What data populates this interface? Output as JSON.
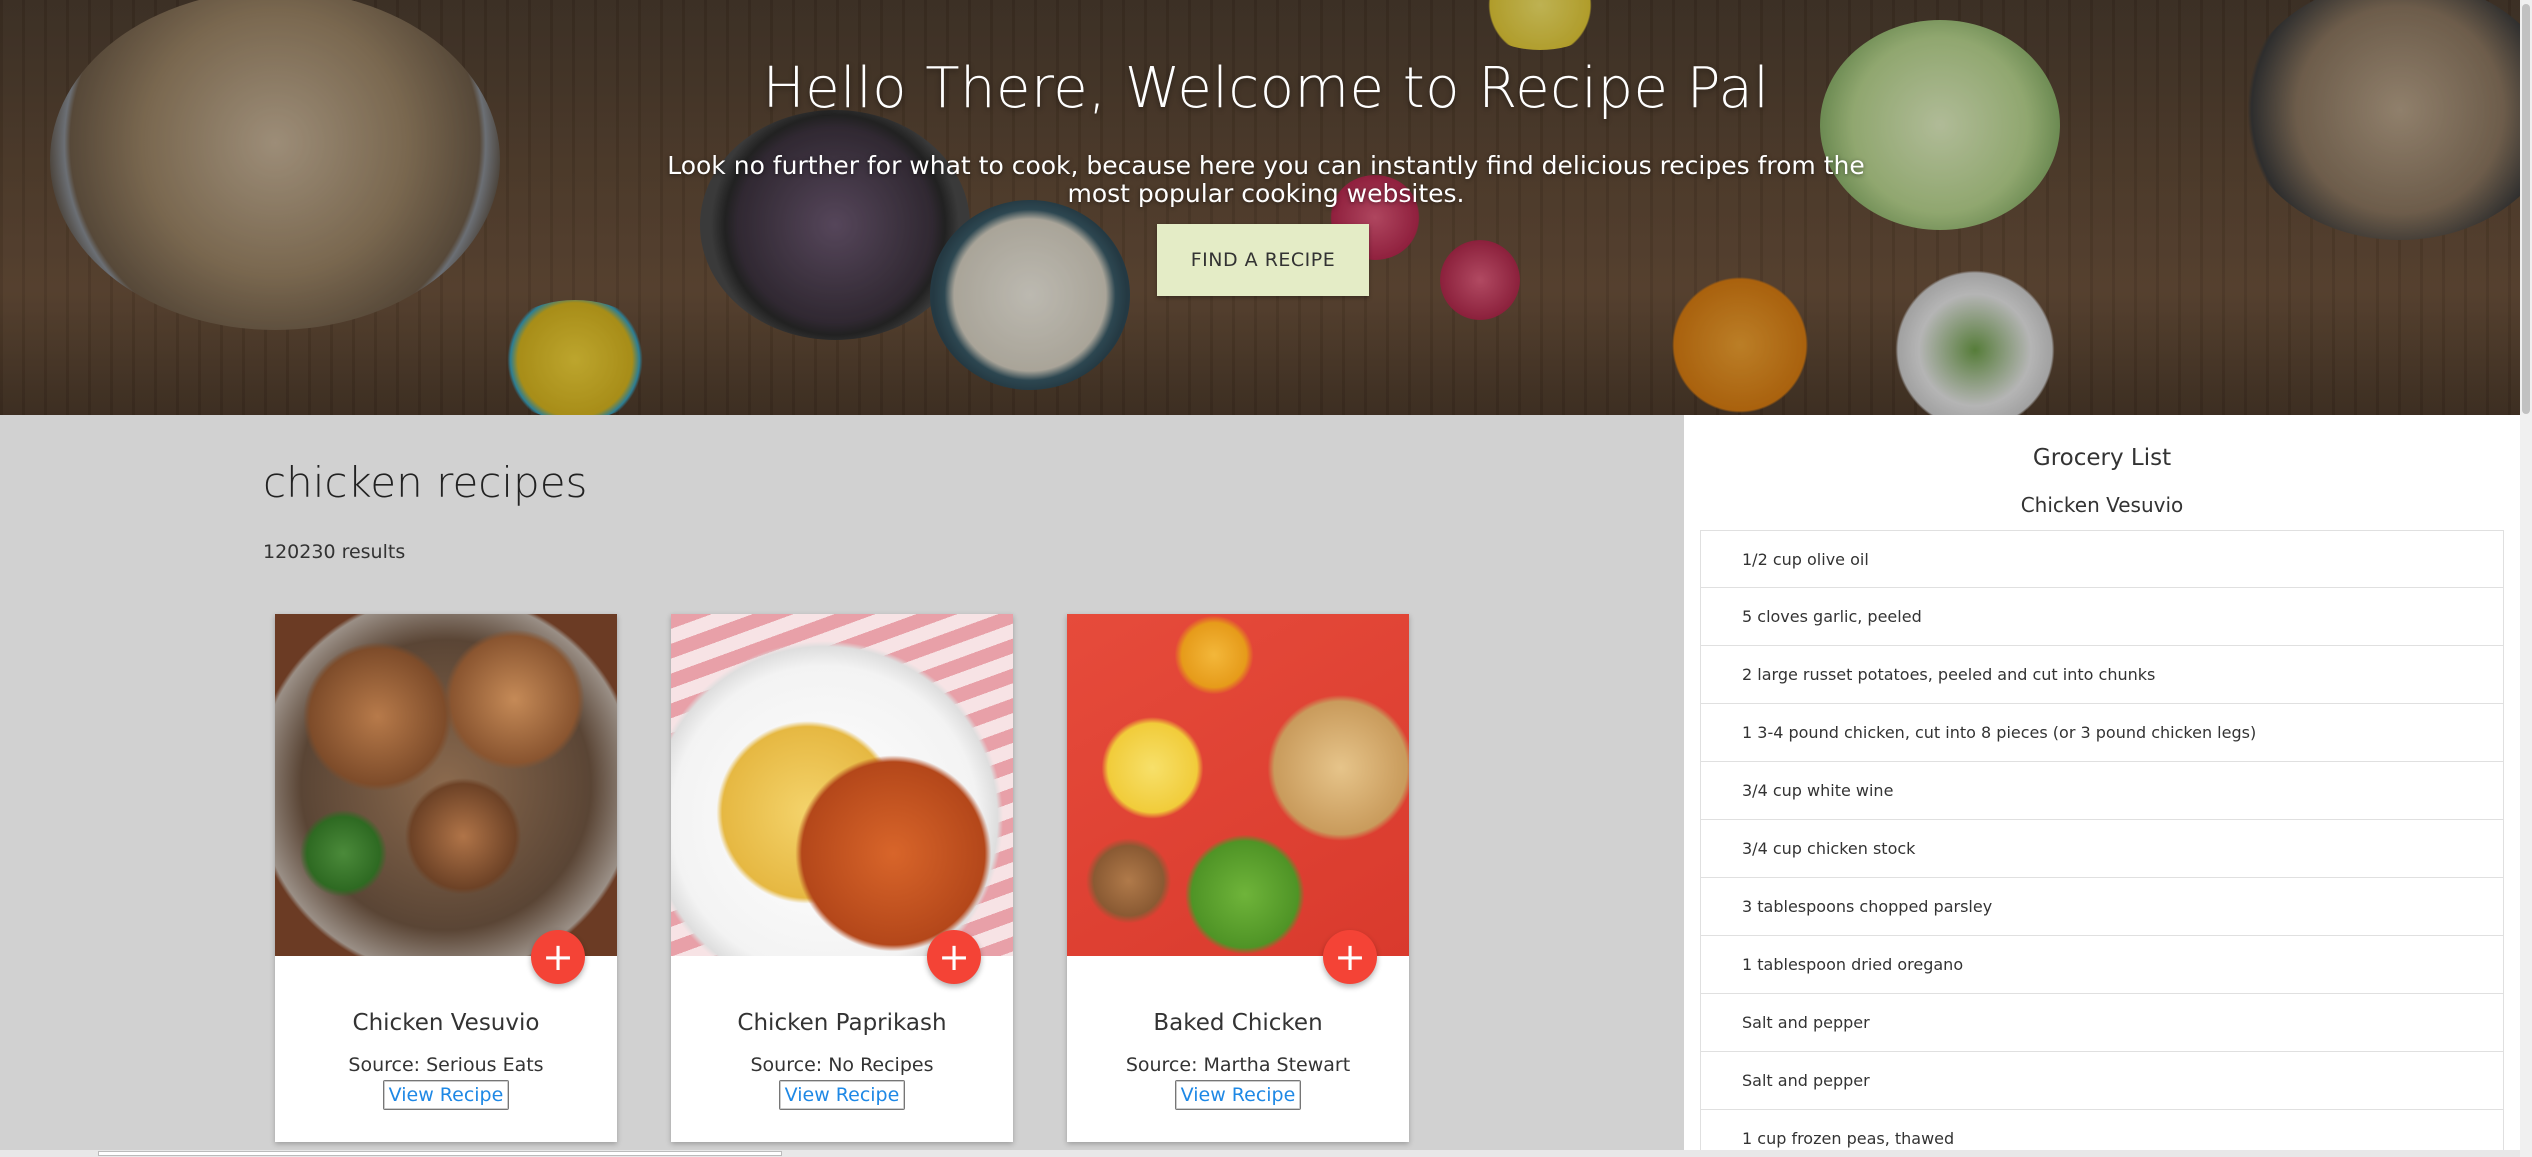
{
  "hero": {
    "title": "Hello There, Welcome to Recipe Pal",
    "subtitle": "Look no further for what to cook, because here you can instantly find delicious recipes from the most popular cooking websites.",
    "button_label": "FIND A RECIPE"
  },
  "results": {
    "title": "chicken recipes",
    "count": "120230 results"
  },
  "cards": [
    {
      "name": "Chicken Vesuvio",
      "source": "Source: Serious Eats",
      "view_label": "View Recipe",
      "add_label": "+"
    },
    {
      "name": "Chicken Paprikash",
      "source": "Source: No Recipes",
      "view_label": "View Recipe",
      "add_label": "+"
    },
    {
      "name": "Baked Chicken",
      "source": "Source: Martha Stewart",
      "view_label": "View Recipe",
      "add_label": "+"
    }
  ],
  "grocery": {
    "title": "Grocery List",
    "recipe": "Chicken Vesuvio",
    "items": [
      "1/2 cup olive oil",
      "5 cloves garlic, peeled",
      "2 large russet potatoes, peeled and cut into chunks",
      "1 3-4 pound chicken, cut into 8 pieces (or 3 pound chicken legs)",
      "3/4 cup white wine",
      "3/4 cup chicken stock",
      "3 tablespoons chopped parsley",
      "1 tablespoon dried oregano",
      "Salt and pepper",
      "Salt and pepper",
      "1 cup frozen peas, thawed"
    ]
  },
  "colors": {
    "accent_fab": "#f44336",
    "find_button": "#e4ecc6",
    "link": "#1e88e5",
    "page_bg": "#d1d1d1"
  }
}
